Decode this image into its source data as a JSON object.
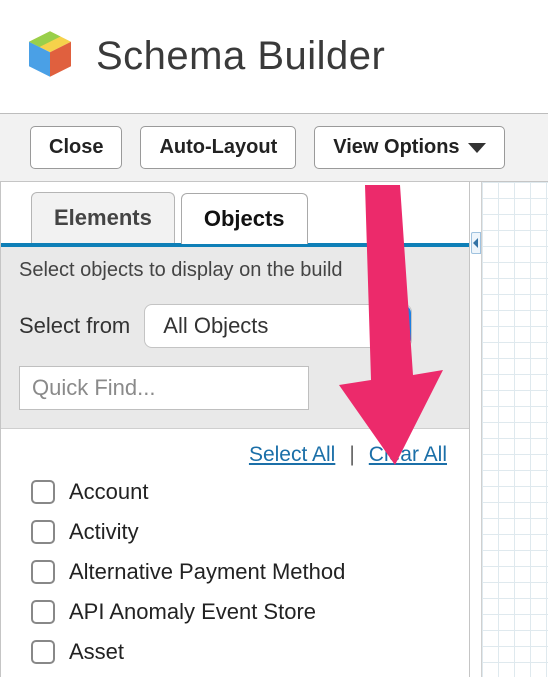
{
  "header": {
    "title": "Schema Builder"
  },
  "toolbar": {
    "close_label": "Close",
    "auto_layout_label": "Auto-Layout",
    "view_options_label": "View Options"
  },
  "tabs": {
    "elements_label": "Elements",
    "objects_label": "Objects"
  },
  "panel": {
    "instruction": "Select objects to display on the build",
    "select_from_label": "Select from",
    "select_from_value": "All Objects",
    "quick_find_placeholder": "Quick Find...",
    "select_all_label": "Select All",
    "clear_all_label": "Clear All",
    "separator": "|"
  },
  "objects": [
    {
      "label": "Account",
      "checked": false
    },
    {
      "label": "Activity",
      "checked": false
    },
    {
      "label": "Alternative Payment Method",
      "checked": false
    },
    {
      "label": "API Anomaly Event Store",
      "checked": false
    },
    {
      "label": "Asset",
      "checked": false
    }
  ],
  "annotation": {
    "arrow_color": "#ec2a6b"
  }
}
